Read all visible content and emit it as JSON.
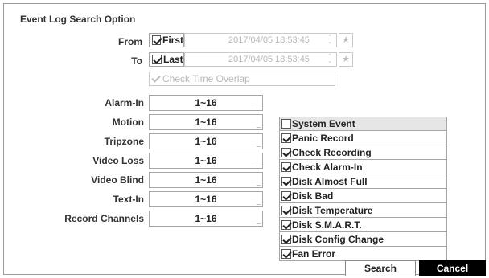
{
  "title": "Event Log Search Option",
  "from": {
    "label": "From",
    "checkbox_label": "First",
    "checked": true,
    "datetime": "2017/04/05  18:53:45"
  },
  "to": {
    "label": "To",
    "checkbox_label": "Last",
    "checked": true,
    "datetime": "2017/04/05  18:53:45"
  },
  "check_time_overlap": {
    "label": "Check Time Overlap",
    "checked": true,
    "disabled": true
  },
  "channel_filters": [
    {
      "label": "Alarm-In",
      "value": "1~16"
    },
    {
      "label": "Motion",
      "value": "1~16"
    },
    {
      "label": "Tripzone",
      "value": "1~16"
    },
    {
      "label": "Video Loss",
      "value": "1~16"
    },
    {
      "label": "Video Blind",
      "value": "1~16"
    },
    {
      "label": "Text-In",
      "value": "1~16"
    },
    {
      "label": "Record Channels",
      "value": "1~16"
    }
  ],
  "system_event": {
    "header": "System Event",
    "header_checked": false,
    "items": [
      {
        "label": "Panic Record",
        "checked": true
      },
      {
        "label": "Check Recording",
        "checked": true
      },
      {
        "label": "Check Alarm-In",
        "checked": true
      },
      {
        "label": "Disk Almost Full",
        "checked": true
      },
      {
        "label": "Disk Bad",
        "checked": true
      },
      {
        "label": "Disk Temperature",
        "checked": true
      },
      {
        "label": "Disk S.M.A.R.T.",
        "checked": true
      },
      {
        "label": "Disk Config Change",
        "checked": true
      },
      {
        "label": "Fan Error",
        "checked": true
      }
    ]
  },
  "buttons": {
    "search": "Search",
    "cancel": "Cancel"
  },
  "icons": {
    "star": "star-icon",
    "spinner": "spinner-arrows-icon",
    "ellipsis": "ellipsis-icon"
  }
}
